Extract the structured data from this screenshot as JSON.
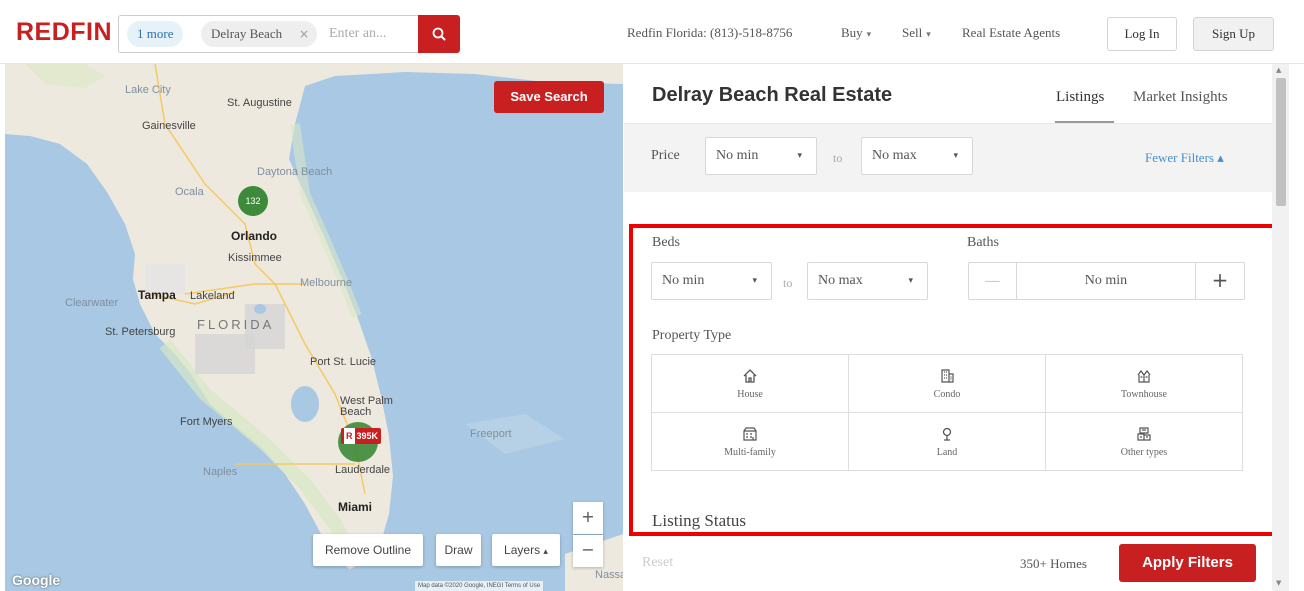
{
  "header": {
    "logo": "REDFIN",
    "search": {
      "chip_more": "1 more",
      "chip_city": "Delray Beach",
      "chip_remove": "×",
      "placeholder": "Enter an..."
    },
    "phone": "Redfin Florida: (813)-518-8756",
    "nav": [
      {
        "label": "Buy",
        "caret": "▾"
      },
      {
        "label": "Sell",
        "caret": "▾"
      },
      {
        "label": "Real Estate Agents"
      }
    ],
    "login_label": "Log In",
    "signup_label": "Sign Up"
  },
  "map": {
    "save_search_label": "Save Search",
    "labels": {
      "lake_city": "Lake City",
      "st_augustine": "St. Augustine",
      "gainesville": "Gainesville",
      "daytona": "Daytona Beach",
      "ocala": "Ocala",
      "orlando": "Orlando",
      "kissimmee": "Kissimmee",
      "tampa": "Tampa",
      "lakeland": "Lakeland",
      "melbourne": "Melbourne",
      "clearwater": "Clearwater",
      "st_petersburg": "St. Petersburg",
      "florida": "FLORIDA",
      "port_st_lucie": "Port St. Lucie",
      "west_palm_beach": "West Palm Beach",
      "fort_myers": "Fort Myers",
      "freeport": "Freeport",
      "naples": "Naples",
      "fort_lauderdale": "Lauderdale",
      "miami": "Miami",
      "nassau": "Nassau"
    },
    "cluster_count": "132",
    "price_pin": {
      "icon_letter": "R",
      "price": "395K"
    },
    "remove_outline_label": "Remove Outline",
    "draw_label": "Draw",
    "layers_label": "Layers",
    "layers_caret": "▴",
    "zoom_in": "+",
    "zoom_out": "−",
    "google": "Google",
    "attribution": "Map data ©2020 Google, INEGI   Terms of Use"
  },
  "panel": {
    "title": "Delray Beach Real Estate",
    "tabs": [
      {
        "label": "Listings",
        "active": true
      },
      {
        "label": "Market Insights",
        "active": false
      }
    ],
    "price": {
      "label": "Price",
      "min": "No min",
      "to": "to",
      "max": "No max",
      "caret": "▾"
    },
    "fewer_filters": "Fewer Filters ▴",
    "beds": {
      "label": "Beds",
      "min": "No min",
      "to": "to",
      "max": "No max",
      "caret": "▾"
    },
    "baths": {
      "label": "Baths",
      "minus": "—",
      "value": "No min",
      "plus": "+"
    },
    "property_type": {
      "label": "Property Type",
      "options": [
        {
          "label": "House",
          "icon": "house-icon"
        },
        {
          "label": "Condo",
          "icon": "condo-icon"
        },
        {
          "label": "Townhouse",
          "icon": "townhouse-icon"
        },
        {
          "label": "Multi-family",
          "icon": "multi-family-icon"
        },
        {
          "label": "Land",
          "icon": "land-icon"
        },
        {
          "label": "Other types",
          "icon": "other-types-icon"
        }
      ]
    },
    "listing_status_label": "Listing Status",
    "footer": {
      "reset_label": "Reset",
      "home_count": "350+ Homes",
      "apply_label": "Apply Filters"
    }
  },
  "colors": {
    "brand_red": "#c82021",
    "highlight_red": "#ee0000",
    "link_blue": "#4a8ecf",
    "map_water": "#a8c8e3",
    "cluster_green": "#3d8a3a"
  }
}
